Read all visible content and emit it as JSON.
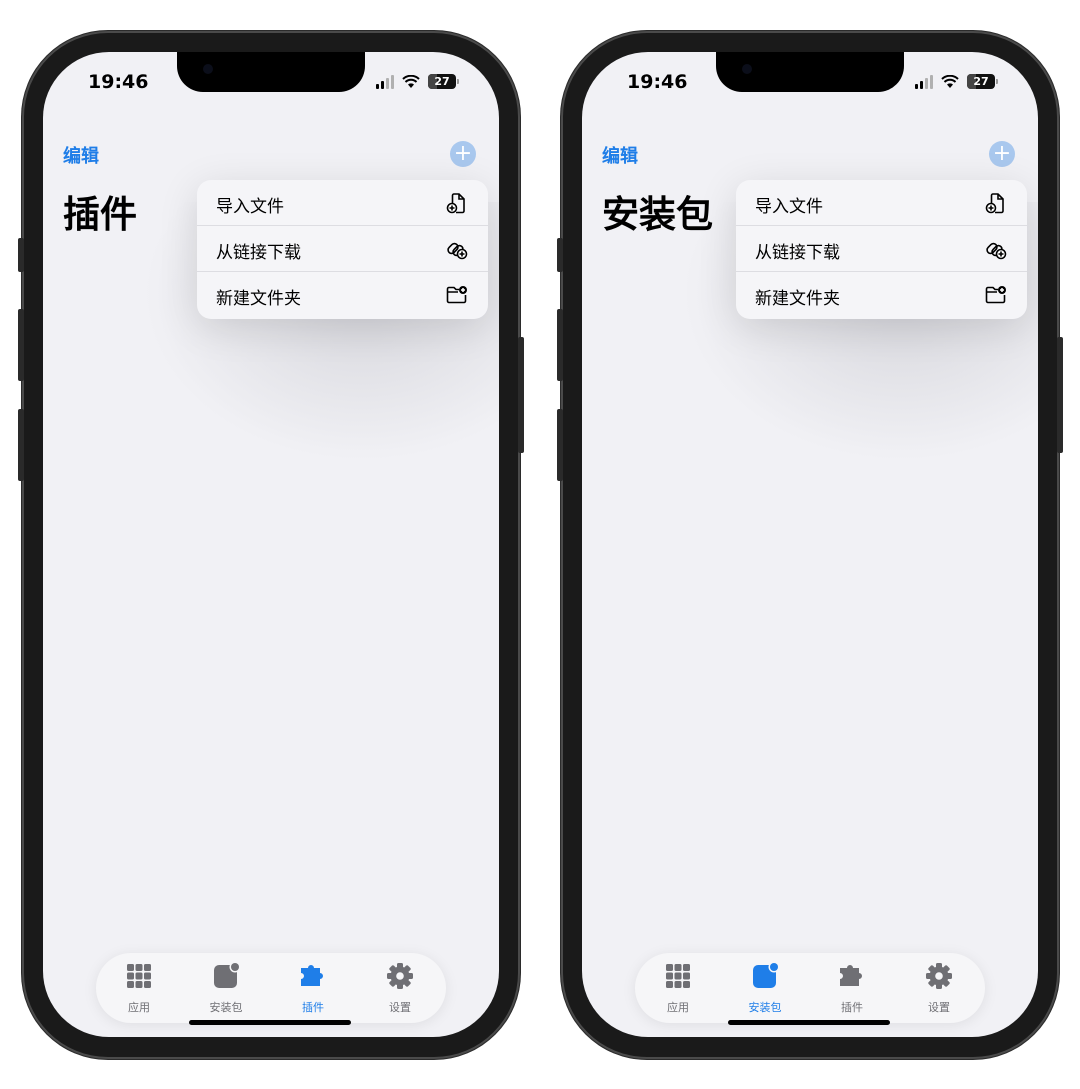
{
  "status": {
    "time": "19:46",
    "battery": "27"
  },
  "colors": {
    "accent": "#1f7ee8",
    "tab_inactive": "#6f6f74",
    "background": "#f1f1f5"
  },
  "nav": {
    "edit_label": "编辑",
    "add_icon": "plus-circle-icon"
  },
  "menu": [
    {
      "label": "导入文件",
      "icon": "document-plus-icon"
    },
    {
      "label": "从链接下载",
      "icon": "link-plus-icon"
    },
    {
      "label": "新建文件夹",
      "icon": "folder-plus-icon"
    }
  ],
  "tabs": [
    {
      "label": "应用",
      "icon": "grid-icon"
    },
    {
      "label": "安装包",
      "icon": "package-icon"
    },
    {
      "label": "插件",
      "icon": "puzzle-icon"
    },
    {
      "label": "设置",
      "icon": "gear-icon"
    }
  ],
  "screens": [
    {
      "title": "插件",
      "active_tab": "插件"
    },
    {
      "title": "安装包",
      "active_tab": "安装包"
    }
  ]
}
